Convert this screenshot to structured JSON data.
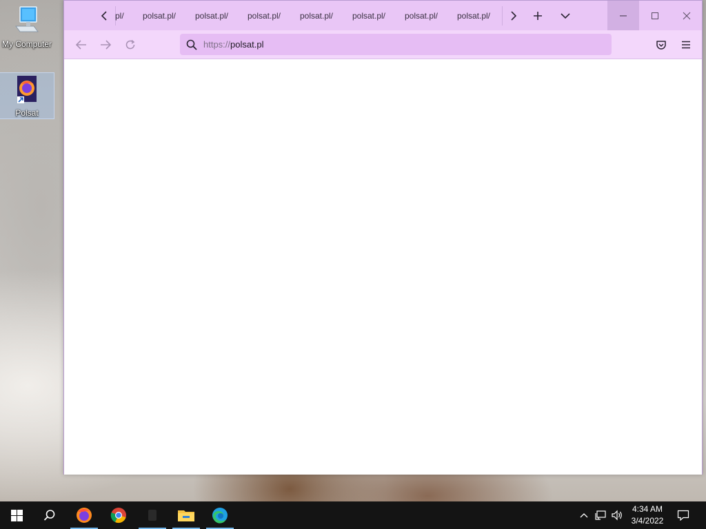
{
  "desktop": {
    "icons": [
      {
        "label": "My Computer",
        "icon": "computer-icon"
      },
      {
        "label": "Polsat",
        "icon": "firefox-shortcut-icon"
      }
    ]
  },
  "browser": {
    "tabs": [
      {
        "label": "pl/"
      },
      {
        "label": "polsat.pl/"
      },
      {
        "label": "polsat.pl/"
      },
      {
        "label": "polsat.pl/"
      },
      {
        "label": "polsat.pl/"
      },
      {
        "label": "polsat.pl/"
      },
      {
        "label": "polsat.pl/"
      },
      {
        "label": "polsat.pl/"
      }
    ],
    "url_scheme": "https://",
    "url_host": "polsat.pl",
    "colors": {
      "tabbar": "#e9c6f6",
      "navbar": "#f3d7fb",
      "urlbar": "#e6bdf4"
    }
  },
  "taskbar": {
    "apps": [
      "windows-start",
      "search",
      "firefox",
      "chrome",
      "unknown-app",
      "file-explorer",
      "edge"
    ],
    "time": "4:34 AM",
    "date": "3/4/2022"
  }
}
